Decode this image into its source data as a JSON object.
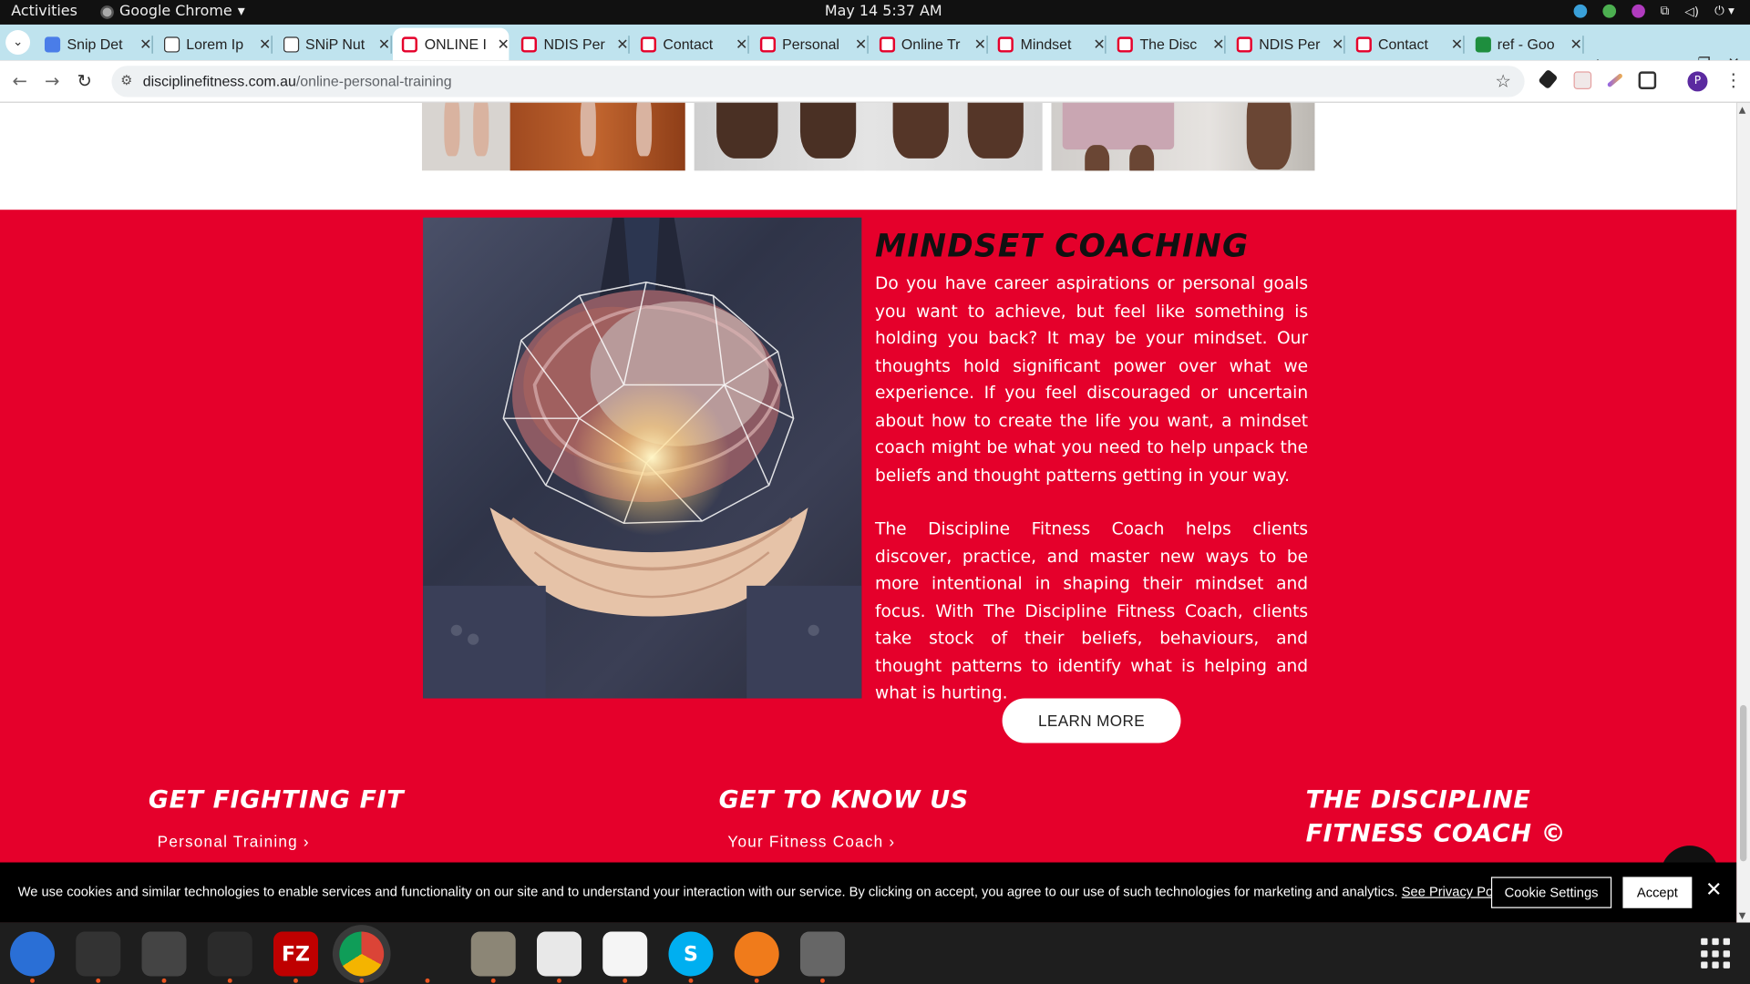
{
  "topbar": {
    "activities": "Activities",
    "app_name": "Google Chrome",
    "clock": "May 14  5:37 AM"
  },
  "tabs": [
    {
      "title": "Snip Det",
      "favicon": "docs-icon",
      "color": "#4a7de8"
    },
    {
      "title": "Lorem Ip",
      "favicon": "lorem-icon",
      "color": "#ffffff"
    },
    {
      "title": "SNiP Nut",
      "favicon": "snip-icon",
      "color": "#ffffff"
    },
    {
      "title": "ONLINE I",
      "favicon": "df-icon",
      "color": "#e5002b",
      "active": true
    },
    {
      "title": "NDIS Per",
      "favicon": "df-icon",
      "color": "#e5002b"
    },
    {
      "title": "Contact",
      "favicon": "df-icon",
      "color": "#e5002b"
    },
    {
      "title": "Personal",
      "favicon": "df-icon",
      "color": "#e5002b"
    },
    {
      "title": "Online Tr",
      "favicon": "df-icon",
      "color": "#e5002b"
    },
    {
      "title": "Mindset",
      "favicon": "df-icon",
      "color": "#e5002b"
    },
    {
      "title": "The Disc",
      "favicon": "df-icon",
      "color": "#e5002b"
    },
    {
      "title": "NDIS Per",
      "favicon": "df-icon",
      "color": "#e5002b"
    },
    {
      "title": "Contact",
      "favicon": "df-icon",
      "color": "#e5002b"
    },
    {
      "title": "ref - Goo",
      "favicon": "sheets-icon",
      "color": "#1e8e3e"
    }
  ],
  "address": {
    "host": "disciplinefitness.com.au",
    "path": "/online-personal-training"
  },
  "section": {
    "title": "MINDSET COACHING",
    "para1": "Do you have career aspirations or personal goals you want to achieve, but feel like something is holding you back? It may be your mindset. Our thoughts hold significant power over what we experience. If you feel discouraged or uncertain about how to create the life you want, a mindset coach might be what you need to help unpack the beliefs and thought patterns getting in your way.",
    "para2": "The Discipline Fitness Coach helps clients discover, practice, and master new ways to be more intentional in shaping their mindset and focus. With The Discipline Fitness Coach, clients take stock of their beliefs, behaviours, and thought patterns to identify what is helping and what is hurting.",
    "cta": "LEARN MORE",
    "accent_color": "#e5002b"
  },
  "footer": {
    "col1_heading": "GET FIGHTING FIT",
    "col1_link": "Personal Training",
    "col2_heading": "GET TO KNOW US",
    "col2_link": "Your Fitness Coach",
    "col3_heading_line1": "THE DISCIPLINE",
    "col3_heading_line2": "FITNESS COACH ©",
    "chevron": "›"
  },
  "cookie": {
    "text": "We use cookies and similar technologies to enable services and functionality on our site and to understand your interaction with our service. By clicking on accept, you agree to our use of such technologies for marketing and analytics.",
    "policy_link": "See Privacy Policy",
    "settings": "Cookie Settings",
    "accept": "Accept"
  },
  "dock": [
    {
      "name": "thunderbird-icon",
      "color": "#2a6fd6"
    },
    {
      "name": "terminal-icon",
      "color": "#333333"
    },
    {
      "name": "calculator-icon",
      "color": "#444444"
    },
    {
      "name": "system-monitor-icon",
      "color": "#2b2b2b"
    },
    {
      "name": "filezilla-icon",
      "color": "#bf0000",
      "label": "FZ"
    },
    {
      "name": "chrome-icon",
      "color": "#ffffff"
    },
    {
      "name": "vscode-icon",
      "color": "#1e1e1e"
    },
    {
      "name": "files-icon",
      "color": "#8c8676"
    },
    {
      "name": "text-editor-icon",
      "color": "#e8e8e8"
    },
    {
      "name": "writer-icon",
      "color": "#f5f5f5"
    },
    {
      "name": "skype-icon",
      "color": "#00aff0",
      "label": "S"
    },
    {
      "name": "burner-icon",
      "color": "#f07b1b"
    },
    {
      "name": "disk-icon",
      "color": "#666666"
    }
  ]
}
